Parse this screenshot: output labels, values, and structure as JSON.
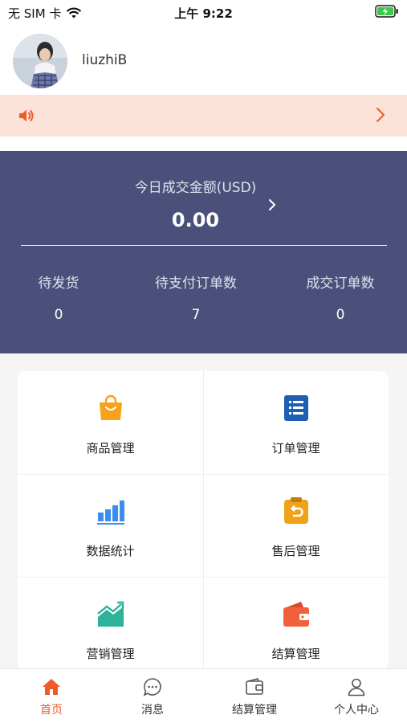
{
  "status_bar": {
    "carrier": "无 SIM 卡",
    "time": "上午 9:22"
  },
  "profile": {
    "username": "liuzhiB"
  },
  "stats": {
    "title": "今日成交金额(USD)",
    "amount": "0.00",
    "items": [
      {
        "label": "待发货",
        "value": "0"
      },
      {
        "label": "待支付订单数",
        "value": "7"
      },
      {
        "label": "成交订单数",
        "value": "0"
      }
    ]
  },
  "menu": [
    {
      "label": "商品管理",
      "icon": "shopping-bag-icon",
      "color": "#f7a21b"
    },
    {
      "label": "订单管理",
      "icon": "order-list-icon",
      "color": "#1f5fb3"
    },
    {
      "label": "数据统计",
      "icon": "bar-chart-icon",
      "color": "#3a8ef0"
    },
    {
      "label": "售后管理",
      "icon": "after-sale-icon",
      "color": "#f0a21a"
    },
    {
      "label": "营销管理",
      "icon": "trend-chart-icon",
      "color": "#2bb49a"
    },
    {
      "label": "结算管理",
      "icon": "wallet-icon",
      "color": "#f2603b"
    }
  ],
  "tabbar": [
    {
      "label": "首页",
      "icon": "home-icon",
      "active": true
    },
    {
      "label": "消息",
      "icon": "message-icon",
      "active": false
    },
    {
      "label": "结算管理",
      "icon": "wallet-icon",
      "active": false
    },
    {
      "label": "个人中心",
      "icon": "user-icon",
      "active": false
    }
  ],
  "colors": {
    "accent": "#f05a2a",
    "stats_bg": "#4a5079",
    "notice_bg": "#fbe3d9"
  }
}
